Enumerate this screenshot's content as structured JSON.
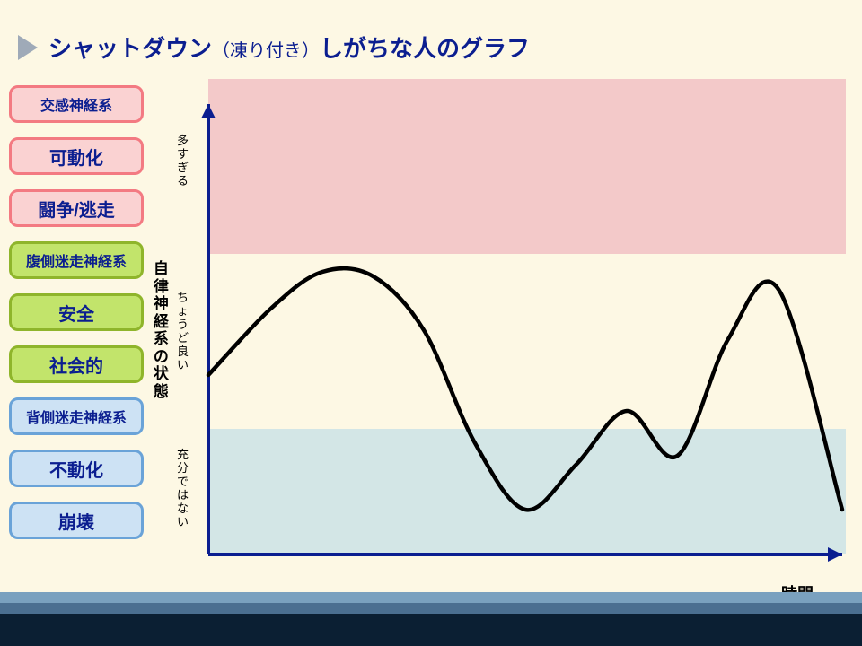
{
  "title": {
    "pre": "シャットダウン",
    "sub": "（凍り付き）",
    "post": "しがちな人のグラフ"
  },
  "legend": {
    "pink": [
      "交感神経系",
      "可動化",
      "闘争/逃走"
    ],
    "green": [
      "腹側迷走神経系",
      "安全",
      "社会的"
    ],
    "blue": [
      "背側迷走神経系",
      "不動化",
      "崩壊"
    ]
  },
  "axes": {
    "y_title": "自律神経系の状態",
    "x_title": "時間",
    "zones": {
      "top": {
        "label": "多すぎる",
        "color": "#f3c9c9"
      },
      "middle": {
        "label": "ちょうど良い",
        "color": "#ffffff"
      },
      "bottom": {
        "label": "充分ではない",
        "color": "#d3e6e6"
      }
    }
  },
  "chart_data": {
    "type": "line",
    "title": "シャットダウン（凍り付き）しがちな人のグラフ",
    "xlabel": "時間",
    "ylabel": "自律神経系の状態",
    "ylim": [
      0,
      100
    ],
    "zone_bounds": {
      "too_much_above": 67,
      "not_enough_below": 28
    },
    "x": [
      0,
      10,
      18,
      26,
      34,
      42,
      50,
      58,
      66,
      74,
      82,
      90,
      100
    ],
    "values": [
      40,
      55,
      63,
      62,
      50,
      25,
      10,
      20,
      32,
      22,
      48,
      59,
      10
    ]
  },
  "footer_colors": [
    "#7aa1bf",
    "#4b6f91",
    "#0b1f33",
    "#0b1f33",
    "#0b1f33"
  ]
}
